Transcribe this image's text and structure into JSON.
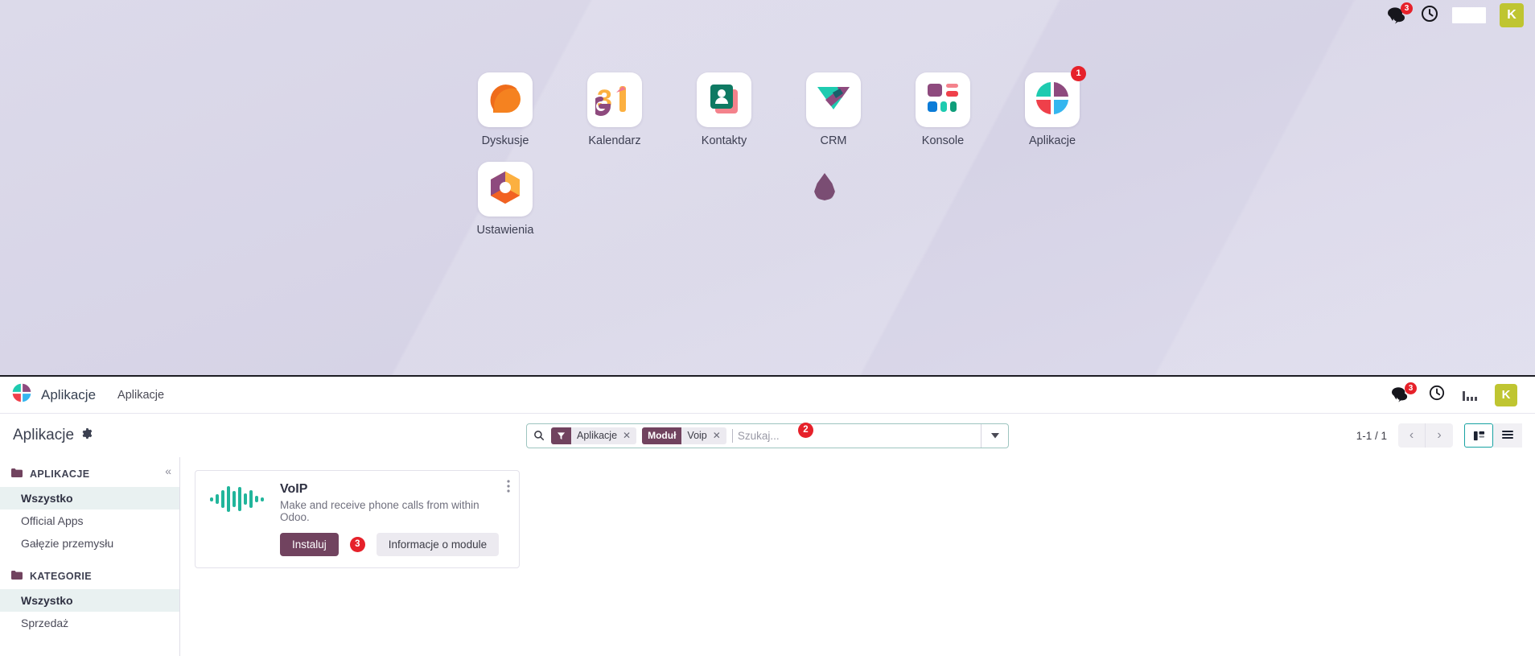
{
  "desktop": {
    "tray": {
      "messages_badge": "3",
      "clock_icon": "clock-icon",
      "messages_icon": "chat-bubbles-icon",
      "avatar_initial": "K"
    },
    "apps": [
      {
        "label": "Dyskusje",
        "icon": "discuss-icon"
      },
      {
        "label": "Kalendarz",
        "icon": "calendar-icon",
        "glyph": "31"
      },
      {
        "label": "Kontakty",
        "icon": "contacts-icon"
      },
      {
        "label": "CRM",
        "icon": "crm-icon"
      },
      {
        "label": "Konsole",
        "icon": "dashboard-icon"
      },
      {
        "label": "Aplikacje",
        "icon": "apps-icon",
        "badge": "1"
      },
      {
        "label": "Ustawienia",
        "icon": "settings-icon"
      }
    ],
    "cursor": "droplet-cursor"
  },
  "odoo": {
    "navbar": {
      "brand": "Aplikacje",
      "breadcrumb": "Aplikacje",
      "messages_badge": "3",
      "avatar_initial": "K"
    },
    "control_panel": {
      "title": "Aplikacje",
      "search": {
        "placeholder": "Szukaj...",
        "value": "",
        "facets": [
          {
            "key_icon": "filter-icon",
            "key": "",
            "value": "Aplikacje"
          },
          {
            "key": "Moduł",
            "value": "Voip"
          }
        ],
        "annotation_badge": "2"
      },
      "pager": "1-1 / 1",
      "views": {
        "kanban": "kanban-view",
        "list": "list-view",
        "active": "kanban"
      }
    },
    "sidebar": {
      "sections": [
        {
          "title": "APLIKACJE",
          "items": [
            {
              "label": "Wszystko",
              "active": true
            },
            {
              "label": "Official Apps",
              "active": false
            },
            {
              "label": "Gałęzie przemysłu",
              "active": false
            }
          ]
        },
        {
          "title": "KATEGORIE",
          "items": [
            {
              "label": "Wszystko",
              "active": true
            },
            {
              "label": "Sprzedaż",
              "active": false
            }
          ]
        }
      ]
    },
    "module_card": {
      "title": "VoIP",
      "description": "Make and receive phone calls from within Odoo.",
      "install_label": "Instaluj",
      "install_badge": "3",
      "info_label": "Informacje o module",
      "icon": "voip-waveform-icon"
    }
  },
  "colors": {
    "accent_purple": "#71435f",
    "badge_red": "#e6212a",
    "avatar_olive": "#bfc531",
    "teal": "#17a2a2",
    "desktop_bg": "#d9d7e8"
  }
}
